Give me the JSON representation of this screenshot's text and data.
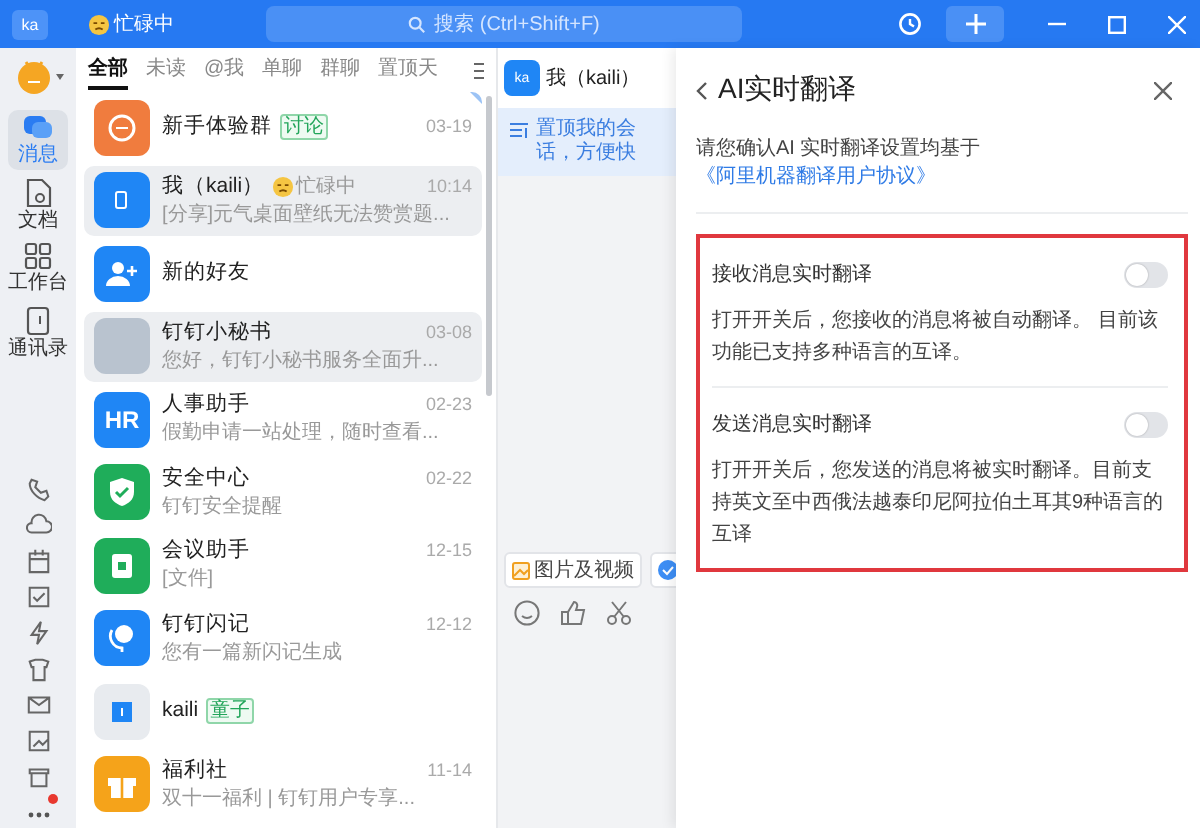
{
  "topbar": {
    "logo": "ka",
    "status": "忙碌中",
    "search": {
      "placeholder": "搜索 (Ctrl+Shift+F)"
    }
  },
  "rail": {
    "items": [
      {
        "label": "消息",
        "selected": true
      },
      {
        "label": "文档",
        "selected": false
      },
      {
        "label": "工作台",
        "selected": false
      },
      {
        "label": "通讯录",
        "selected": false
      }
    ],
    "more_notification": true
  },
  "chat_list": {
    "tabs": [
      {
        "label": "全部",
        "selected": true
      },
      {
        "label": "未读",
        "selected": false
      },
      {
        "label": "@我",
        "selected": false
      },
      {
        "label": "单聊",
        "selected": false
      },
      {
        "label": "群聊",
        "selected": false
      },
      {
        "label": "置顶天",
        "selected": false
      }
    ],
    "rows": [
      {
        "name": "新手体验群",
        "badge": "讨论",
        "time": "03-19",
        "selected": false,
        "pinned": true,
        "avatar": {
          "kind": "icon",
          "color": "#f07c3e"
        }
      },
      {
        "name": "我（kaili）",
        "status": "忙碌中",
        "time": "10:14",
        "preview": "[分享]元气桌面壁纸无法赞赏题...",
        "selected": true,
        "pinned": false,
        "avatar": {
          "kind": "icon",
          "color": "#1f86f5"
        }
      },
      {
        "name": "新的好友",
        "selected": false,
        "pinned": false,
        "avatar": {
          "kind": "icon",
          "color": "#1f86f5"
        }
      },
      {
        "name": "钉钉小秘书",
        "time": "03-08",
        "preview": "您好，钉钉小秘书服务全面升...",
        "selected": true,
        "pinned": false,
        "avatar": {
          "kind": "photo",
          "color": "#b9c3cf"
        }
      },
      {
        "name": "人事助手",
        "time": "02-23",
        "preview": "假勤申请一站处理，随时查看...",
        "selected": false,
        "pinned": false,
        "avatar": {
          "kind": "text",
          "color": "#1f86f5",
          "text": "HR"
        }
      },
      {
        "name": "安全中心",
        "time": "02-22",
        "preview": "钉钉安全提醒",
        "selected": false,
        "pinned": false,
        "avatar": {
          "kind": "icon",
          "color": "#1fad5a"
        }
      },
      {
        "name": "会议助手",
        "time": "12-15",
        "preview": "[文件]",
        "selected": false,
        "pinned": false,
        "avatar": {
          "kind": "icon",
          "color": "#1fad5a"
        }
      },
      {
        "name": "钉钉闪记",
        "time": "12-12",
        "preview": "您有一篇新闪记生成",
        "selected": false,
        "pinned": false,
        "avatar": {
          "kind": "icon",
          "color": "#1f86f5"
        }
      },
      {
        "name": "kaili",
        "badge": "童子",
        "selected": false,
        "pinned": false,
        "avatar": {
          "kind": "icon",
          "color": "#e8ebef"
        }
      },
      {
        "name": "福利社",
        "time": "11-14",
        "preview": "双十一福利 | 钉钉用户专享...",
        "selected": false,
        "pinned": false,
        "avatar": {
          "kind": "icon",
          "color": "#f5a31a"
        }
      }
    ]
  },
  "chat": {
    "avatar": "ka",
    "name": "我（kaili）",
    "notice": "置顶我的会话，方便快",
    "chips": [
      "图片及视频"
    ]
  },
  "panel": {
    "title": "AI实时翻译",
    "notice": {
      "text": "请您确认AI 实时翻译设置均基于",
      "link": "《阿里机器翻译用户协议》"
    },
    "settings": [
      {
        "title": "接收消息实时翻译",
        "on": false,
        "description": "打开开关后，您接收的消息将被自动翻译。 目前该功能已支持多种语言的互译。"
      },
      {
        "title": "发送消息实时翻译",
        "on": false,
        "description": "打开开关后，您发送的消息将被实时翻译。目前支持英文至中西俄法越泰印尼阿拉伯土耳其9种语言的互译"
      }
    ]
  }
}
